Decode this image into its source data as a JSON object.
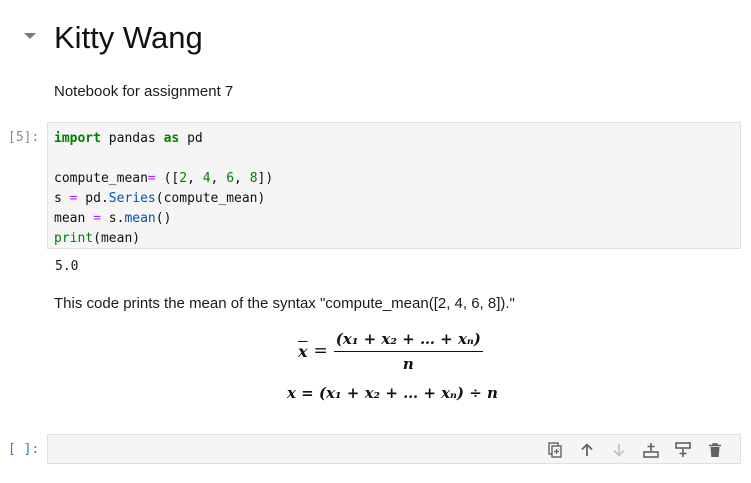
{
  "heading": {
    "title": "Kitty Wang",
    "subtitle": "Notebook for assignment 7"
  },
  "code_cell": {
    "prompt": "[5]:",
    "lines": [
      "import pandas as pd",
      "",
      "compute_mean= ([2, 4, 6, 8])",
      "s = pd.Series(compute_mean)",
      "mean = s.mean()",
      "print(mean)"
    ],
    "output": "5.0"
  },
  "markdown": {
    "description": "This code prints the mean of the syntax \"compute_mean([2, 4, 6, 8]).\"",
    "formula_lhs": "x",
    "formula_eq": "=",
    "formula_numerator": "(x₁ + x₂ + … + xₙ)",
    "formula_denominator": "n",
    "formula_inline": "x = (x₁ + x₂ + … + xₙ) ÷ n"
  },
  "empty_cell": {
    "prompt": "[ ]:"
  },
  "toolbar": {
    "buttons": [
      "duplicate-icon",
      "move-up-icon",
      "move-down-icon",
      "insert-above-icon",
      "insert-below-icon",
      "delete-icon"
    ]
  },
  "colors": {
    "keyword": "#008000",
    "operator": "#aa22ff",
    "attribute": "#0055aa",
    "prompt_active": "#307fc1",
    "cell_background": "#f5f5f5"
  }
}
